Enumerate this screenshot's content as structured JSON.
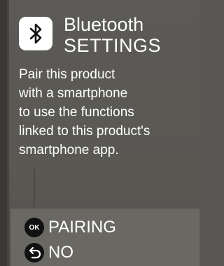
{
  "header": {
    "icon": "bluetooth-icon",
    "title_line1": "Bluetooth",
    "title_line2": "SETTINGS"
  },
  "description": {
    "lines": [
      "Pair this product",
      "with a smartphone",
      "to use the functions",
      "linked to this product's",
      "smartphone app."
    ]
  },
  "actions": {
    "ok": {
      "badge": "OK",
      "label": "PAIRING",
      "icon": "ok-button-icon"
    },
    "back": {
      "label": "NO",
      "icon": "back-arrow-icon"
    }
  },
  "colors": {
    "background": "#5a5854",
    "action_bar": "#6a6863",
    "text": "#ffffff",
    "badge": "#111111"
  }
}
